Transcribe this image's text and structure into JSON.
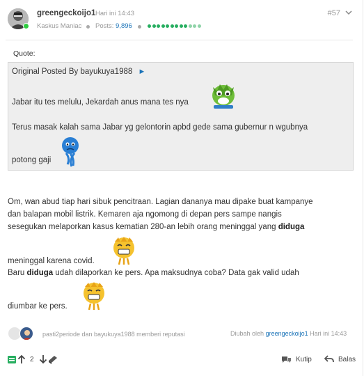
{
  "post": {
    "username": "greengeckoijo1",
    "time": "Hari ini 14:43",
    "number": "#57",
    "rank": "Kaskus Maniac",
    "posts_label": "Posts:",
    "posts_count": "9,896",
    "reputation_level": 0.75
  },
  "quote": {
    "title": "Quote:",
    "original_prefix": "Original Posted By",
    "original_user": "bayukuya1988",
    "arrow": "►",
    "line1": "Jabar itu tes melulu, Jekardah anus mana tes nya",
    "line2": "Terus masak kalah sama Jabar yg gelontorin apbd gede sama gubernur n wgubnya",
    "line3": "potong gaji"
  },
  "body": {
    "l1": "Om, wan abud tiap hari sibuk pencitraan. Lagian dananya mau dipake buat kampanye",
    "l2": "dan balapan mobil listrik. Kemaren aja ngomong di depan pers sampe nangis",
    "l3_pre": "sesegukan melaporkan kasus kematian 280-an lebih orang meninggal yang ",
    "l3_bold": "diduga",
    "l4": "meninggal karena covid.",
    "l5_pre": "Baru ",
    "l5_bold": "diduga",
    "l5_post": " udah dilaporkan ke pers. Apa maksudnya coba? Data gak valid udah",
    "l6": "diumbar ke pers."
  },
  "footer": {
    "reputation_text": "pasti2periode dan bayukuya1988 memberi reputasi",
    "edited_prefix": "Diubah oleh",
    "edited_user": "greengeckoijo1",
    "edited_time": "Hari ini 14:43",
    "vote_count": "2",
    "quote_label": "Kutip",
    "reply_label": "Balas"
  },
  "colors": {
    "link": "#1a73b8",
    "online": "#2ecc40",
    "reputation": "#27ae60"
  },
  "icons": [
    "chevron-down-icon",
    "cendol-icon",
    "upvote-icon",
    "downvote-icon",
    "bata-icon",
    "quote-icon",
    "reply-icon"
  ]
}
